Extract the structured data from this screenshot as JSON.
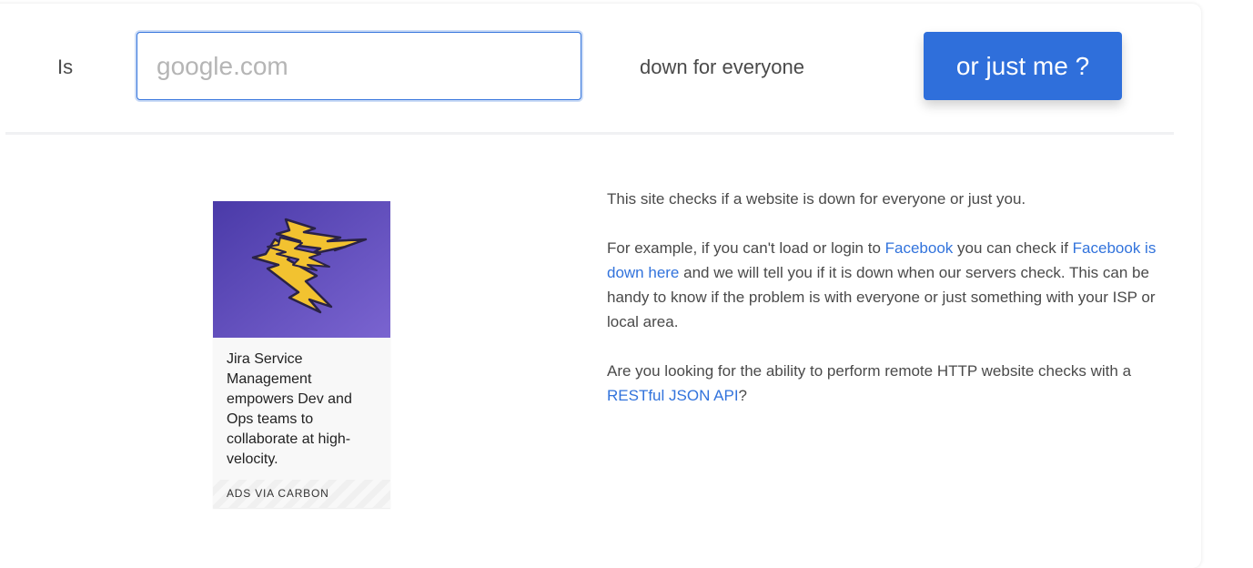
{
  "hero": {
    "is_label": "Is",
    "input_placeholder": "google.com",
    "input_value": "",
    "down_label": "down for everyone",
    "button_label": "or just me ?"
  },
  "ad": {
    "text": "Jira Service Management empowers Dev and Ops teams to collaborate at high-velocity.",
    "footer": "ADS VIA CARBON"
  },
  "content": {
    "p1": "This site checks if a website is down for everyone or just you.",
    "p2_before": "For example, if you can't load or login to ",
    "p2_link1": "Facebook",
    "p2_middle": " you can check if ",
    "p2_link2": "Facebook is down here",
    "p2_after": " and we will tell you if it is down when our servers check. This can be handy to know if the problem is with everyone or just something with your ISP or local area.",
    "p3_before": "Are you looking for the ability to perform remote HTTP website checks with a ",
    "p3_link": "RESTful JSON API",
    "p3_after": "?"
  },
  "colors": {
    "accent": "#2f6fdb",
    "link": "#3273dc",
    "text": "#4a4a4a",
    "ad_background": "#5a49b2",
    "bolt": "#f2c230"
  }
}
